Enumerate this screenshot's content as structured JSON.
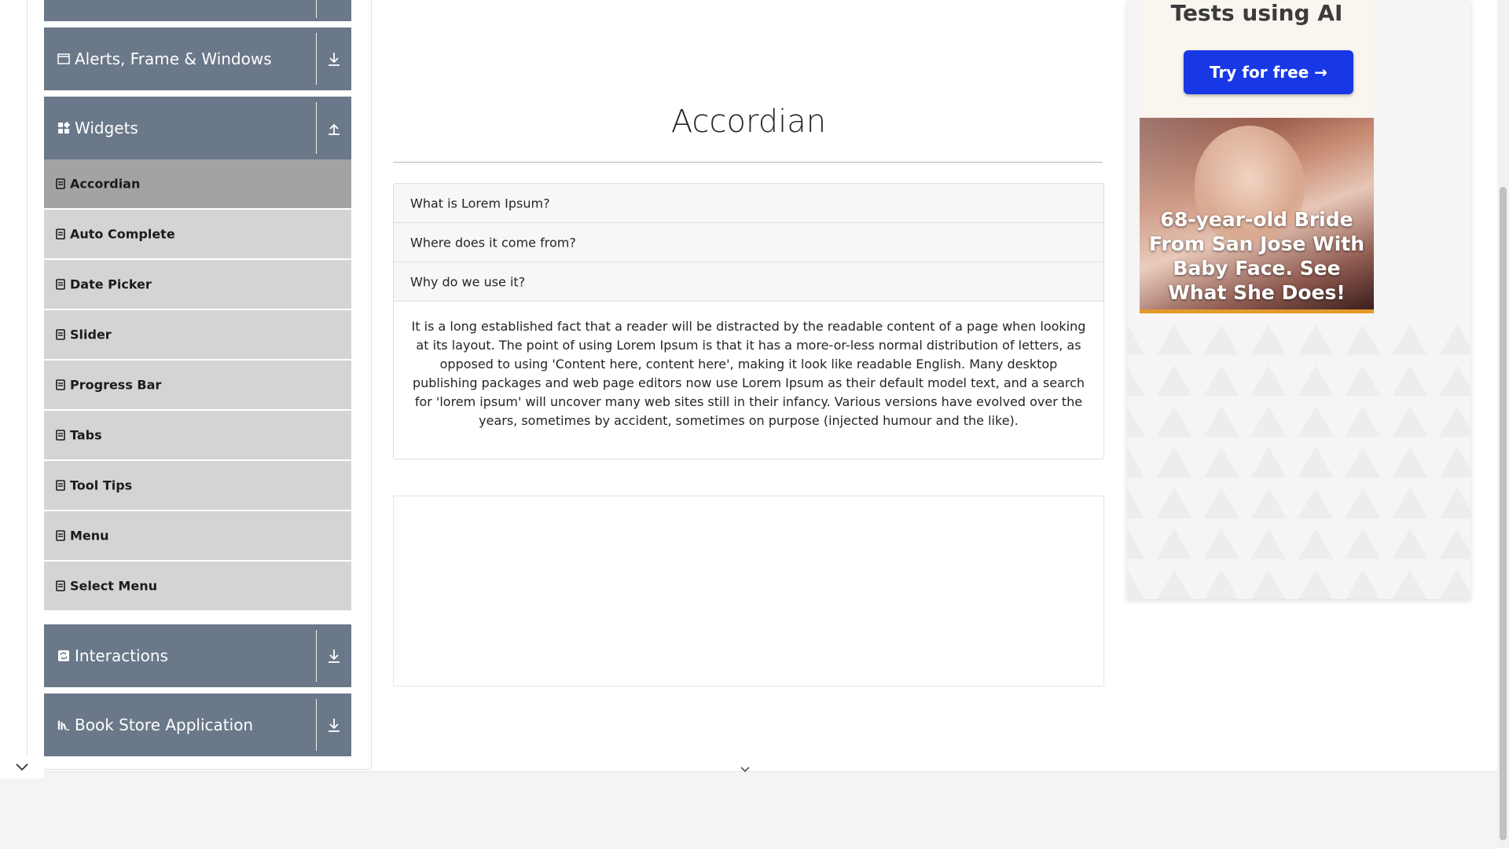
{
  "sidebar": {
    "groups": [
      {
        "title": "Alerts, Frame & Windows",
        "icon": "window-icon",
        "state": "collapsed"
      },
      {
        "title": "Widgets",
        "icon": "widgets-grid-icon",
        "state": "expanded"
      },
      {
        "title": "Interactions",
        "icon": "interactions-icon",
        "state": "collapsed"
      },
      {
        "title": "Book Store Application",
        "icon": "book-store-icon",
        "state": "collapsed"
      }
    ],
    "widgets_items": [
      {
        "label": "Accordian",
        "active": true
      },
      {
        "label": "Auto Complete",
        "active": false
      },
      {
        "label": "Date Picker",
        "active": false
      },
      {
        "label": "Slider",
        "active": false
      },
      {
        "label": "Progress Bar",
        "active": false
      },
      {
        "label": "Tabs",
        "active": false
      },
      {
        "label": "Tool Tips",
        "active": false
      },
      {
        "label": "Menu",
        "active": false
      },
      {
        "label": "Select Menu",
        "active": false
      }
    ]
  },
  "main": {
    "title": "Accordian",
    "sections": [
      {
        "heading": "What is Lorem Ipsum?",
        "expanded": false
      },
      {
        "heading": "Where does it come from?",
        "expanded": false
      },
      {
        "heading": "Why do we use it?",
        "expanded": true
      }
    ],
    "expanded_body": "It is a long established fact that a reader will be distracted by the readable content of a page when looking at its layout. The point of using Lorem Ipsum is that it has a more-or-less normal distribution of letters, as opposed to using 'Content here, content here', making it look like readable English. Many desktop publishing packages and web page editors now use Lorem Ipsum as their default model text, and a search for 'lorem ipsum' will uncover many web sites still in their infancy. Various versions have evolved over the years, sometimes by accident, sometimes on purpose (injected humour and the like)."
  },
  "ad": {
    "heading_fragment": "Tests using AI",
    "cta": "Try for free →",
    "photo_caption": "68-year-old Bride From San Jose With Baby Face. See What She Does!"
  },
  "colors": {
    "group_header_bg": "#6a7889",
    "menu_item_bg": "#d4d4d4",
    "menu_item_active_bg": "#a3a3a3",
    "cta_blue": "#1838e6",
    "photo_border": "#e49a2a"
  }
}
